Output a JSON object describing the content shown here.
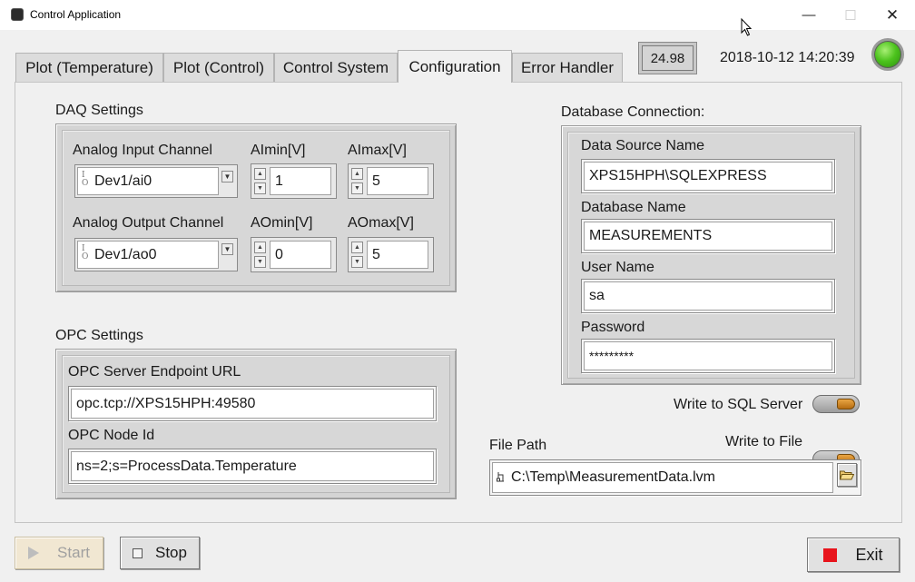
{
  "window": {
    "title": "Control Application",
    "controls": {
      "minimize": "—",
      "maximize": "☐",
      "close": "✕"
    }
  },
  "tabs": [
    {
      "label": "Plot (Temperature)"
    },
    {
      "label": "Plot (Control)"
    },
    {
      "label": "Control System"
    },
    {
      "label": "Configuration",
      "active": true
    },
    {
      "label": "Error Handler"
    }
  ],
  "header": {
    "value_indicator": "24.98",
    "datetime": "2018-10-12 14:20:39",
    "status_led_color": "#4cc31d"
  },
  "daq": {
    "section_label": "DAQ Settings",
    "analog_input_label": "Analog Input Channel",
    "analog_input_value": "Dev1/ai0",
    "aimin_label": "AImin[V]",
    "aimin_value": "1",
    "aimax_label": "AImax[V]",
    "aimax_value": "5",
    "analog_output_label": "Analog Output Channel",
    "analog_output_value": "Dev1/ao0",
    "aomin_label": "AOmin[V]",
    "aomin_value": "0",
    "aomax_label": "AOmax[V]",
    "aomax_value": "5",
    "io_glyph_top": "I",
    "io_glyph_bottom": "O"
  },
  "opc": {
    "section_label": "OPC Settings",
    "endpoint_label": "OPC Server Endpoint URL",
    "endpoint_value": "opc.tcp://XPS15HPH:49580",
    "node_label": "OPC Node Id",
    "node_value": "ns=2;s=ProcessData.Temperature"
  },
  "database": {
    "section_label": "Database Connection:",
    "dsn_label": "Data Source Name",
    "dsn_value": "XPS15HPH\\SQLEXPRESS",
    "dbname_label": "Database Name",
    "dbname_value": "MEASUREMENTS",
    "user_label": "User Name",
    "user_value": "sa",
    "password_label": "Password",
    "password_value": "*********"
  },
  "output": {
    "write_sql_label": "Write to SQL Server",
    "write_file_label": "Write to File",
    "file_path_label": "File Path",
    "file_path_value": "C:\\Temp\\MeasurementData.lvm"
  },
  "buttons": {
    "start": "Start",
    "stop": "Stop",
    "exit": "Exit"
  },
  "colors": {
    "toggle_on": "#d08a26",
    "exit_square": "#e8141c",
    "start_disabled_bg": "#f1e7d2"
  }
}
